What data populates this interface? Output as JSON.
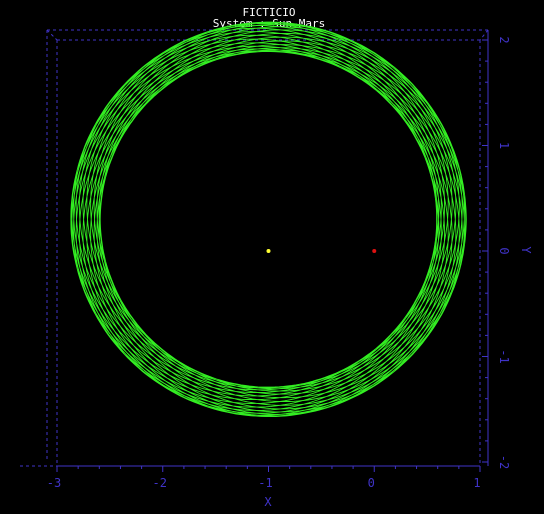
{
  "chart_data": {
    "type": "line",
    "title": "FICTICIO",
    "subtitle": "System : Sun-Mars",
    "xlabel": "X",
    "ylabel": "Y",
    "xlim": [
      -3.0,
      1.0
    ],
    "ylim": [
      -2.0,
      2.0
    ],
    "x_ticks": [
      "-3",
      "-2",
      "-1",
      "0",
      "1"
    ],
    "y_ticks": [
      "-2",
      "-1",
      "0",
      "1",
      "2"
    ],
    "grid": false,
    "orbit": {
      "center": [
        -1.0,
        0.3
      ],
      "radius_mean": 1.73,
      "radius_amplitude": 0.14,
      "color": "#33ee22"
    },
    "bodies": [
      {
        "x": -1.0,
        "y": 0.0,
        "color": "#ffff33"
      },
      {
        "x": 0.0,
        "y": 0.0,
        "color": "#dd1111"
      }
    ],
    "colors": {
      "background": "#000000",
      "axis": "#3f33c8",
      "title": "#ffffff"
    }
  }
}
